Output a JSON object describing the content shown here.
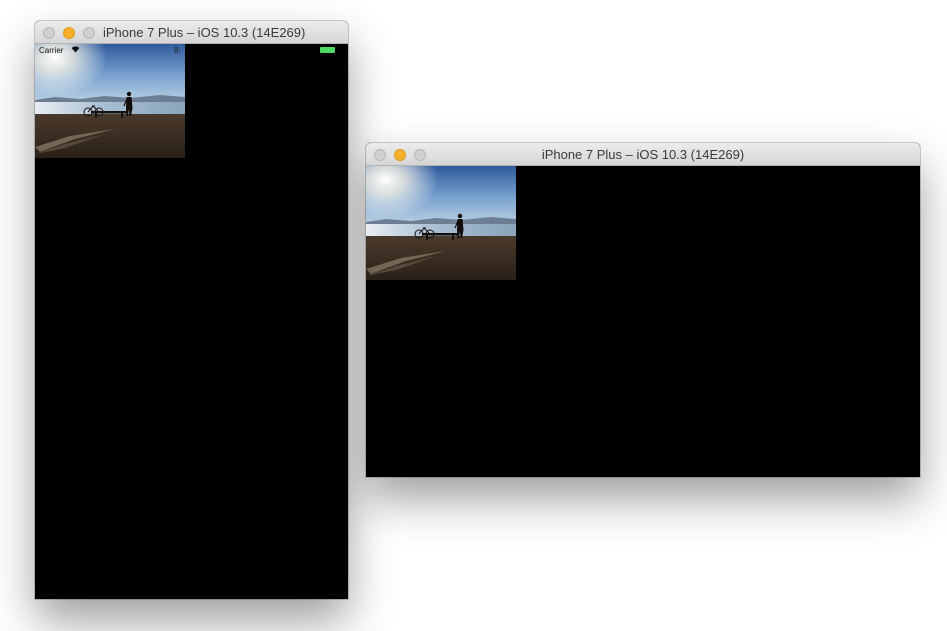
{
  "windows": {
    "portrait": {
      "title": "iPhone 7 Plus – iOS 10.3 (14E269)",
      "status_bar": {
        "carrier": "Carrier",
        "time": "8:"
      },
      "icons": {
        "wifi": "wifi-icon",
        "battery": "battery-icon"
      }
    },
    "landscape": {
      "title": "iPhone 7 Plus – iOS 10.3 (14E269)"
    }
  },
  "colors": {
    "minimize_button": "#f6b02c",
    "battery": "#4cd964",
    "screen_background": "#000000"
  }
}
